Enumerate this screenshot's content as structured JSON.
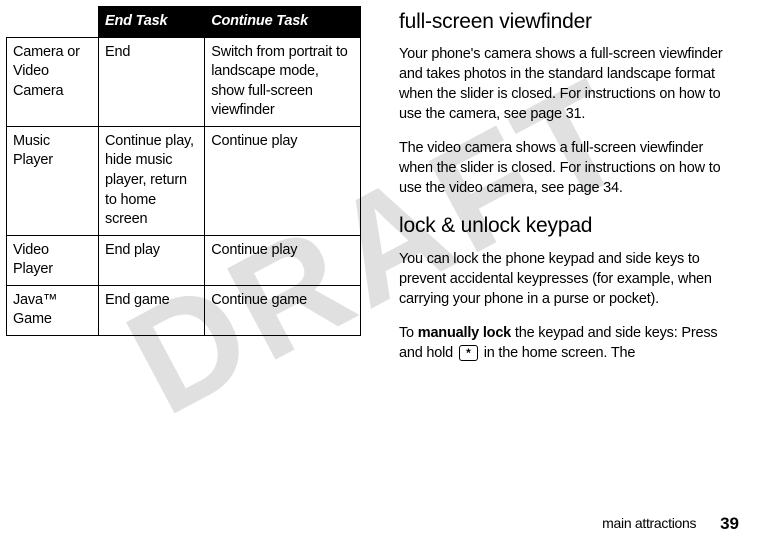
{
  "watermark": "DRAFT",
  "table": {
    "headers": {
      "col1": "",
      "col2": "End Task",
      "col3": "Continue Task"
    },
    "rows": [
      {
        "c1": "Camera or Video Camera",
        "c2": "End",
        "c3": "Switch from portrait to landscape mode, show full-screen viewfinder"
      },
      {
        "c1": "Music Player",
        "c2": "Continue play, hide music player, return to home screen",
        "c3": "Continue play"
      },
      {
        "c1": "Video Player",
        "c2": "End play",
        "c3": "Continue play"
      },
      {
        "c1": "Java™ Game",
        "c2": "End game",
        "c3": "Continue game"
      }
    ]
  },
  "sections": {
    "viewfinder": {
      "heading": "full-screen viewfinder",
      "p1": "Your phone's camera shows a full-screen viewfinder and takes photos in the standard landscape format when the slider is closed. For instructions on how to use the camera, see page 31.",
      "p2": "The video camera shows a full-screen viewfinder when the slider is closed. For instructions on how to use the video camera, see page 34."
    },
    "lock": {
      "heading": "lock & unlock keypad",
      "p1": "You can lock the phone keypad and side keys to prevent accidental keypresses (for example, when carrying your phone in a purse or pocket).",
      "p2a": "To ",
      "p2b": "manually lock",
      "p2c": " the keypad and side keys: Press and hold ",
      "p2key": "*",
      "p2d": " in the home screen. The"
    }
  },
  "footer": {
    "section": "main attractions",
    "page": "39"
  }
}
